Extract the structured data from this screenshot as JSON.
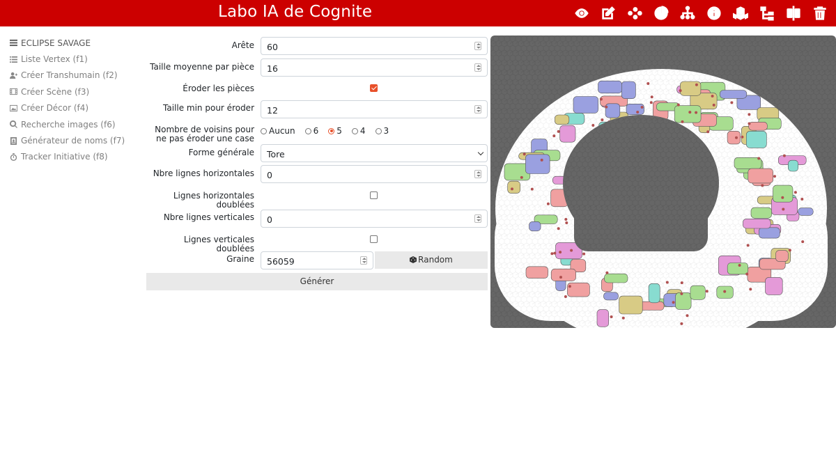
{
  "header": {
    "title": "Labo IA de Cognite"
  },
  "toolbar": {
    "icons": [
      "eye-icon",
      "edit-icon",
      "network-icon",
      "pie-icon",
      "hierarchy-icon",
      "info-icon",
      "cubes-icon",
      "tree-icon",
      "split-icon",
      "trash-icon"
    ]
  },
  "sidebar": {
    "items": [
      {
        "label": "ECLIPSE SAVAGE",
        "icon": "menu-icon"
      },
      {
        "label": "Liste Vertex (f1)",
        "icon": "list-icon"
      },
      {
        "label": "Créer Transhumain (f2)",
        "icon": "user-plus-icon"
      },
      {
        "label": "Créer Scène (f3)",
        "icon": "film-icon"
      },
      {
        "label": "Créer Décor (f4)",
        "icon": "image-icon"
      },
      {
        "label": "Recherche images (f6)",
        "icon": "search-icon"
      },
      {
        "label": "Générateur de noms (f7)",
        "icon": "address-book-icon"
      },
      {
        "label": "Tracker Initiative (f8)",
        "icon": "stopwatch-icon"
      }
    ]
  },
  "form": {
    "arete": {
      "label": "Arête",
      "value": "60"
    },
    "taille_moyenne": {
      "label": "Taille moyenne par pièce",
      "value": "16"
    },
    "eroder": {
      "label": "Éroder les pièces",
      "checked": true
    },
    "taille_min": {
      "label": "Taille min pour éroder",
      "value": "12"
    },
    "voisins": {
      "label": "Nombre de voisins pour ne pas éroder une case",
      "options": [
        "Aucun",
        "6",
        "5",
        "4",
        "3"
      ],
      "selected": "5"
    },
    "forme": {
      "label": "Forme générale",
      "value": "Tore"
    },
    "lignes_h": {
      "label": "Nbre lignes horizontales",
      "value": "0"
    },
    "lignes_h_doublees": {
      "label": "Lignes horizontales doublées",
      "checked": false
    },
    "lignes_v": {
      "label": "Nbre lignes verticales",
      "value": "0"
    },
    "lignes_v_doublees": {
      "label": "Lignes verticales doublées",
      "checked": false
    },
    "graine": {
      "label": "Graine",
      "value": "56059"
    },
    "random_button": "Random",
    "generate_button": "Générer"
  },
  "colors": {
    "brand": "#cc0000",
    "accent": "#e8502a",
    "map_background": "#666666",
    "piece_colors": [
      "#d8cb85",
      "#9aa0e0",
      "#a8dd90",
      "#e49ad8",
      "#f0a0a0",
      "#88dcd0"
    ]
  }
}
